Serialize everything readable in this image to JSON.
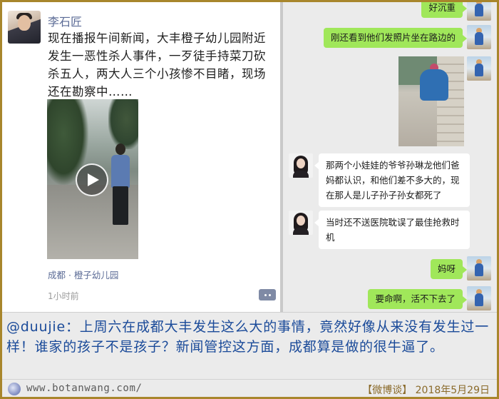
{
  "post": {
    "author": "李石匠",
    "text": "现在播报午间新闻，大丰橙子幼儿园附近发生一恶性杀人事件，一歹徒手持菜刀砍杀五人，两大人三个小孩惨不目睹，现场还在勘察中……",
    "location": "成都 · 橙子幼儿园",
    "time": "1小时前"
  },
  "chat": {
    "messages": [
      {
        "side": "right",
        "text": "好沉重"
      },
      {
        "side": "right",
        "text": "刚还看到他们发照片坐在路边的"
      },
      {
        "side": "left",
        "text": "那两个小娃娃的爷爷孙琳龙他们爸妈都认识，和他们差不多大的，现在那人是儿子孙子孙女都死了"
      },
      {
        "side": "left",
        "text": "当时还不送医院耽误了最佳抢救时机"
      },
      {
        "side": "right",
        "text": "妈呀"
      },
      {
        "side": "right",
        "text": "要命啊，活不下去了"
      }
    ]
  },
  "caption": {
    "text": "@duujie：上周六在成都大丰发生这么大的事情，竟然好像从来没有发生过一样！谁家的孩子不是孩子？新闻管控这方面，成都算是做的很牛逼了。"
  },
  "footer": {
    "url": "www.botanwang.com/",
    "source": "【微博谈】 2018年5月29日"
  },
  "colors": {
    "accent_link": "#5b6b96",
    "caption_text": "#1a4a99",
    "bubble_green": "#a0e75a",
    "frame": "#a8862c"
  }
}
